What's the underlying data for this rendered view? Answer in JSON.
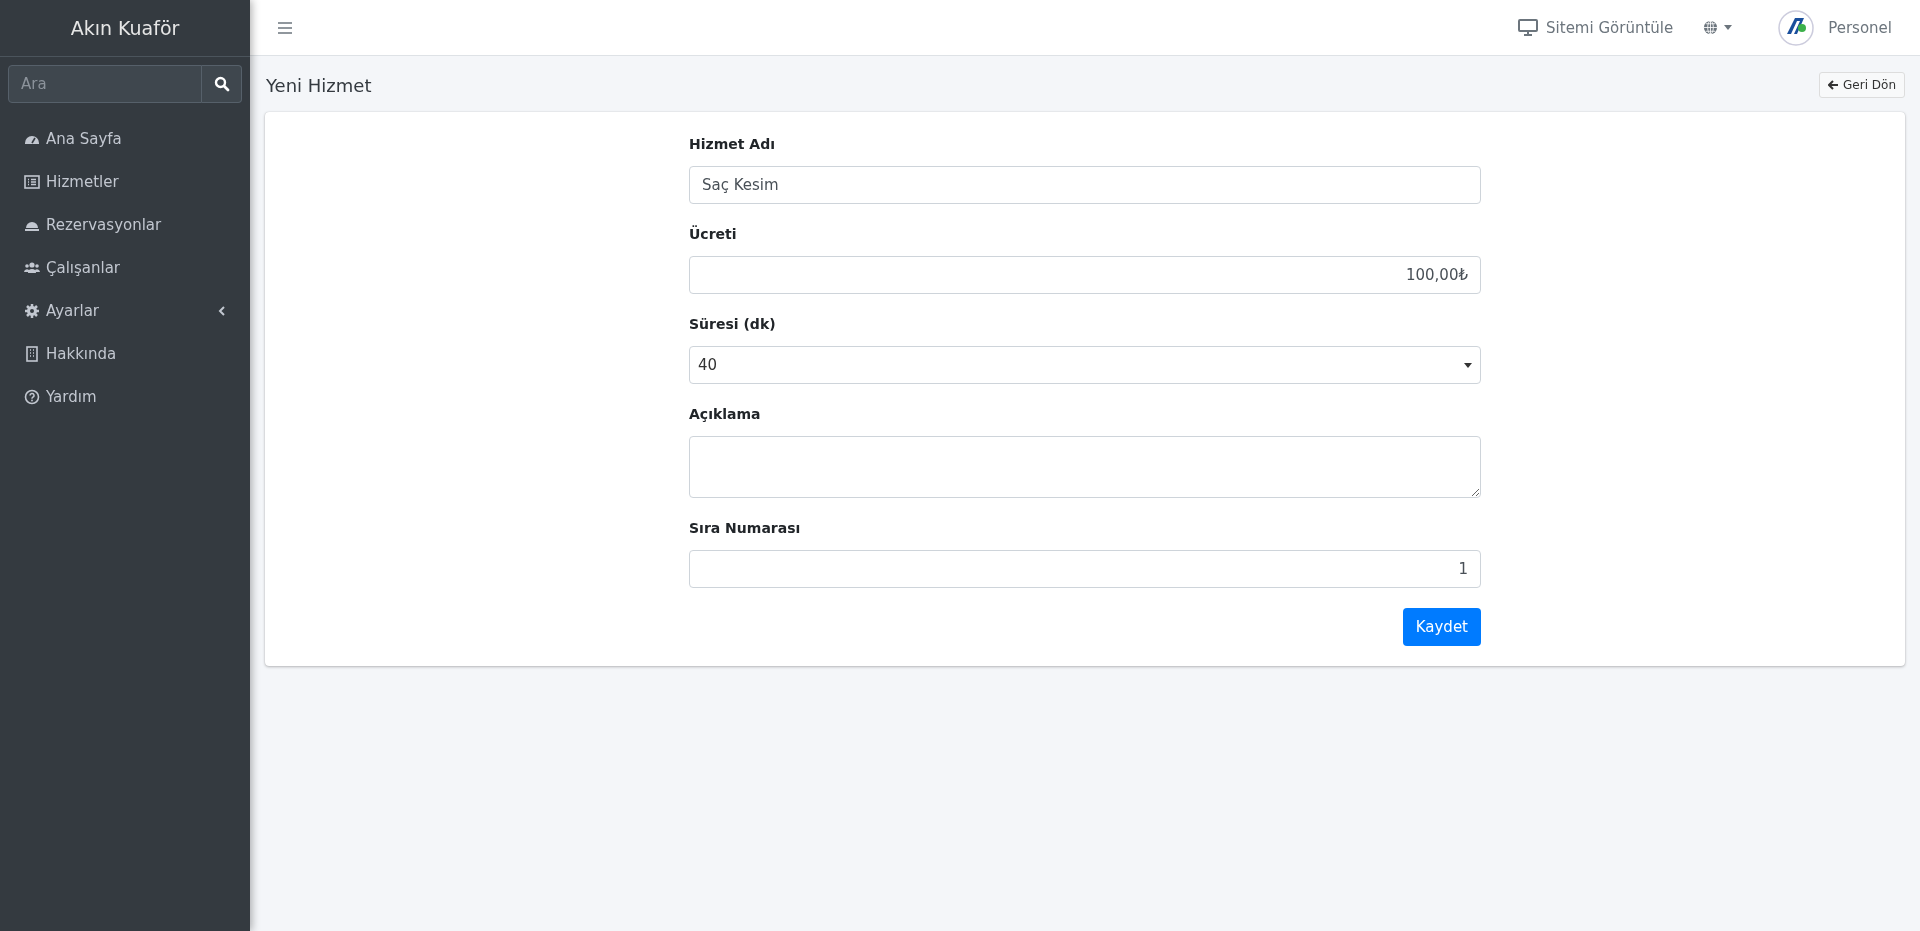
{
  "sidebar": {
    "brand": "Akın Kuaför",
    "search": {
      "placeholder": "Ara"
    },
    "items": [
      {
        "label": "Ana Sayfa",
        "selected": false
      },
      {
        "label": "Hizmetler",
        "selected": false
      },
      {
        "label": "Rezervasyonlar",
        "selected": false
      },
      {
        "label": "Çalışanlar",
        "selected": false
      },
      {
        "label": "Ayarlar",
        "selected": false,
        "expanded": false
      },
      {
        "label": "Hakkında",
        "selected": false
      },
      {
        "label": "Yardım",
        "selected": false
      }
    ]
  },
  "topbar": {
    "view_site": "Sitemi Görüntüle",
    "user": "Personel"
  },
  "page": {
    "title": "Yeni Hizmet",
    "back_button": "Geri Dön"
  },
  "form": {
    "fields": [
      {
        "kind": "text",
        "label": "Hizmet Adı",
        "value": "Saç Kesim"
      },
      {
        "kind": "number",
        "label": "Ücreti",
        "value": "100,00₺"
      },
      {
        "kind": "select",
        "label": "Süresi (dk)",
        "value": "40"
      },
      {
        "kind": "textarea",
        "label": "Açıklama"
      },
      {
        "kind": "number",
        "label": "Sıra Numarası",
        "value": "1"
      }
    ],
    "submit": "Kaydet"
  }
}
